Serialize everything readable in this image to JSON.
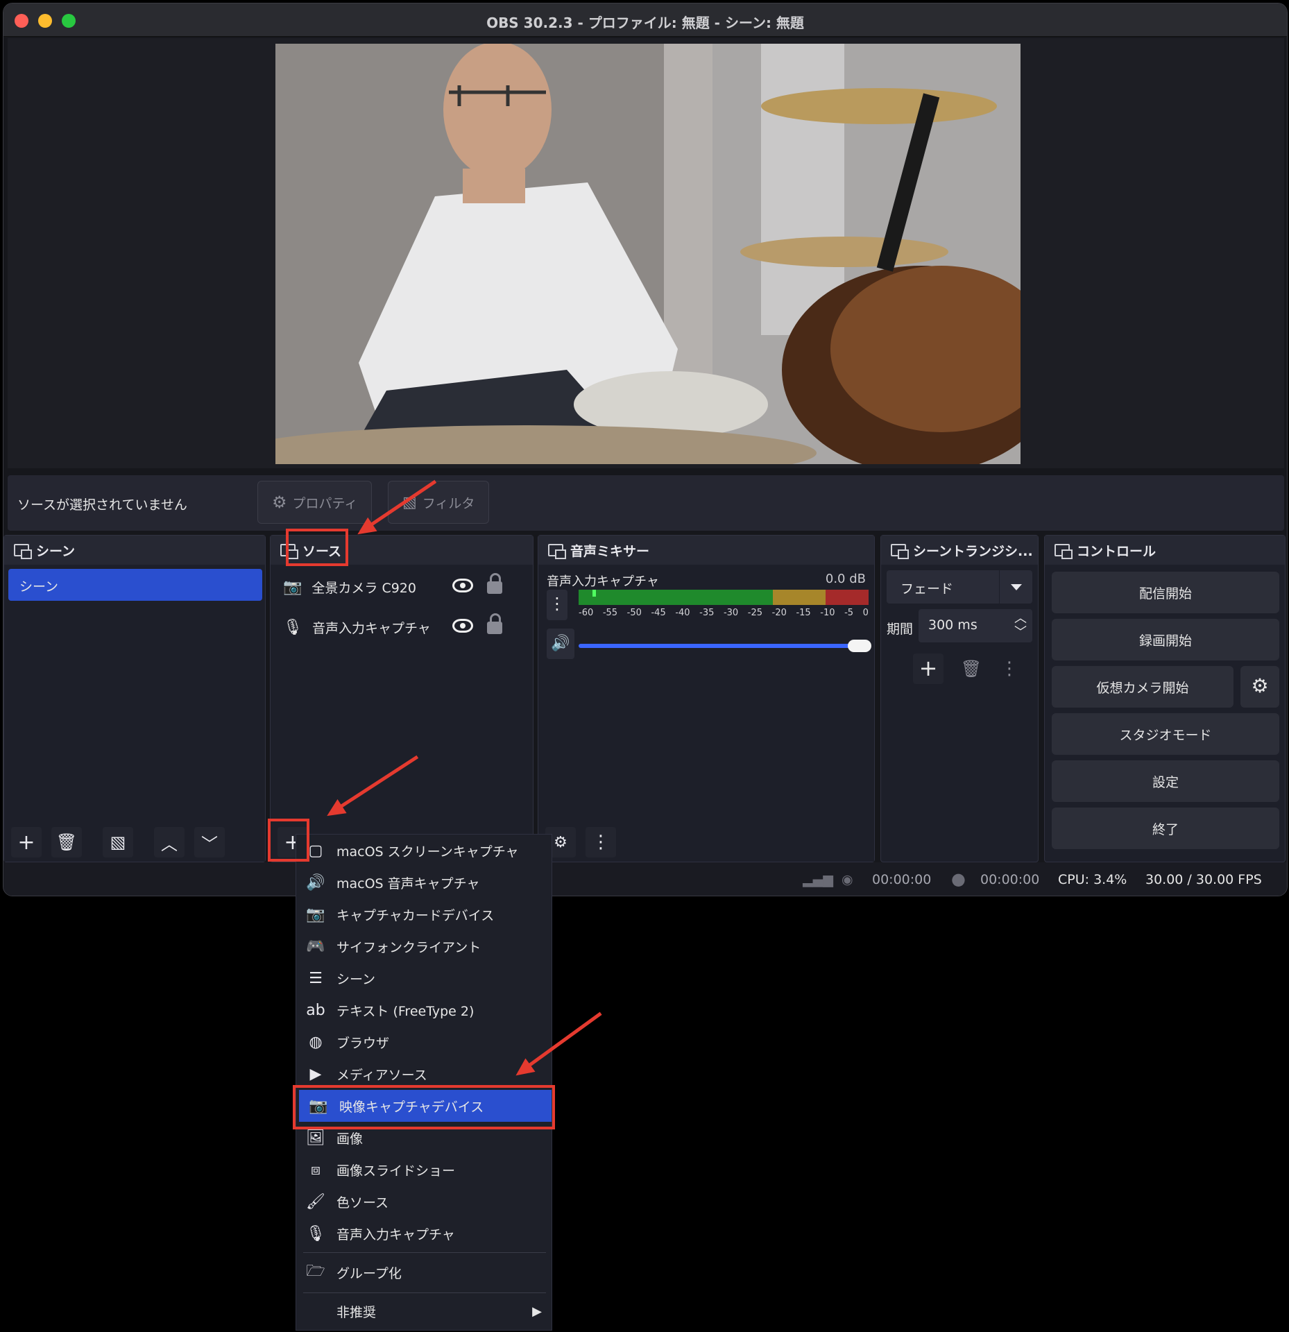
{
  "window": {
    "title": "OBS 30.2.3 - プロファイル: 無題 - シーン: 無題"
  },
  "props": {
    "no_selection": "ソースが選択されていません",
    "properties": "プロパティ",
    "filters": "フィルタ"
  },
  "docks": {
    "scenes": {
      "title": "シーン",
      "items": [
        "シーン"
      ]
    },
    "sources": {
      "title": "ソース",
      "items": [
        {
          "icon": "camera-icon",
          "label": "全景カメラ C920"
        },
        {
          "icon": "microphone-icon",
          "label": "音声入力キャプチャ"
        }
      ]
    },
    "mixer": {
      "title": "音声ミキサー",
      "channel": "音声入力キャプチャ",
      "db": "0.0 dB",
      "scale": [
        "-60",
        "-55",
        "-50",
        "-45",
        "-40",
        "-35",
        "-30",
        "-25",
        "-20",
        "-15",
        "-10",
        "-5",
        "0"
      ],
      "volume_fraction": 1.0
    },
    "transitions": {
      "title": "シーントランジシ...",
      "selected": "フェード",
      "duration_label": "期間",
      "duration": "300 ms"
    },
    "controls": {
      "title": "コントロール",
      "buttons": [
        "配信開始",
        "録画開始",
        "仮想カメラ開始",
        "スタジオモード",
        "設定",
        "終了"
      ]
    }
  },
  "status": {
    "stream_time": "00:00:00",
    "rec_time": "00:00:00",
    "cpu": "CPU: 3.4%",
    "fps": "30.00 / 30.00 FPS"
  },
  "menu": {
    "items": [
      {
        "icon": "display-icon",
        "label": "macOS スクリーンキャプチャ"
      },
      {
        "icon": "speaker-icon",
        "label": "macOS 音声キャプチャ"
      },
      {
        "icon": "camera-icon",
        "label": "キャプチャカードデバイス"
      },
      {
        "icon": "gamepad-icon",
        "label": "サイフォンクライアント"
      },
      {
        "icon": "list-icon",
        "label": "シーン"
      },
      {
        "icon": "text-icon",
        "label": "テキスト (FreeType 2)"
      },
      {
        "icon": "globe-icon",
        "label": "ブラウザ"
      },
      {
        "icon": "play-icon",
        "label": "メディアソース"
      },
      {
        "icon": "camera-icon",
        "label": "映像キャプチャデバイス"
      },
      {
        "icon": "image-icon",
        "label": "画像"
      },
      {
        "icon": "slideshow-icon",
        "label": "画像スライドショー"
      },
      {
        "icon": "brush-icon",
        "label": "色ソース"
      },
      {
        "icon": "microphone-icon",
        "label": "音声入力キャプチャ"
      }
    ],
    "group": "グループ化",
    "deprecated": "非推奨",
    "selected_index": 8
  },
  "colors": {
    "accent": "#2a4fcf",
    "annotation": "#e53a2f",
    "meter_green": "#1f8a2c",
    "meter_yellow": "#a7862a",
    "meter_red": "#a52a2a"
  }
}
